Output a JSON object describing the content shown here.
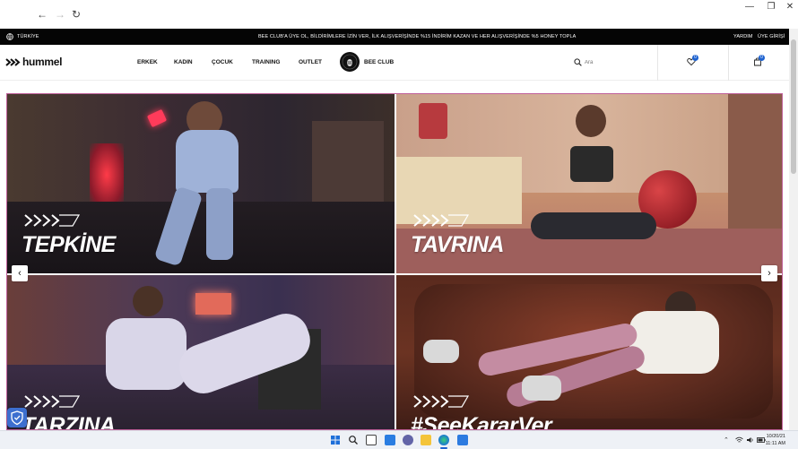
{
  "browser": {
    "back_glyph": "←",
    "forward_glyph": "→",
    "reload_glyph": "↻",
    "minimize_glyph": "—",
    "maximize_glyph": "❐",
    "close_glyph": "✕"
  },
  "topbar": {
    "region": "TÜRKİYE",
    "promo": "BEE CLUB'A ÜYE OL, BİLDİRİMLERE İZİN VER, İLK ALIŞVERİŞİNDE %15 İNDİRİM KAZAN VE HER ALIŞVERİŞİNDE %5 HONEY TOPLA",
    "help": "YARDIM",
    "login": "ÜYE GİRİŞİ"
  },
  "header": {
    "logo": "hummel",
    "menu": [
      "ERKEK",
      "KADIN",
      "ÇOCUK",
      "TRAINING",
      "OUTLET"
    ],
    "bee_club": "BEE CLUB",
    "search_placeholder": "Ara",
    "wishlist_count": "0",
    "cart_count": "0"
  },
  "hero": {
    "tiles": [
      {
        "title": "TEPKİNE"
      },
      {
        "title": "TAVRINA"
      },
      {
        "title": "TARZINA"
      },
      {
        "title": "#SeeKararVer"
      }
    ],
    "prev_glyph": "‹",
    "next_glyph": "›"
  },
  "taskbar": {
    "time": "11:11 AM",
    "date": "10/20/21"
  },
  "colors": {
    "accent_border": "#c0609a",
    "topbar_bg": "#050505",
    "badge_blue": "#1e62d0"
  }
}
